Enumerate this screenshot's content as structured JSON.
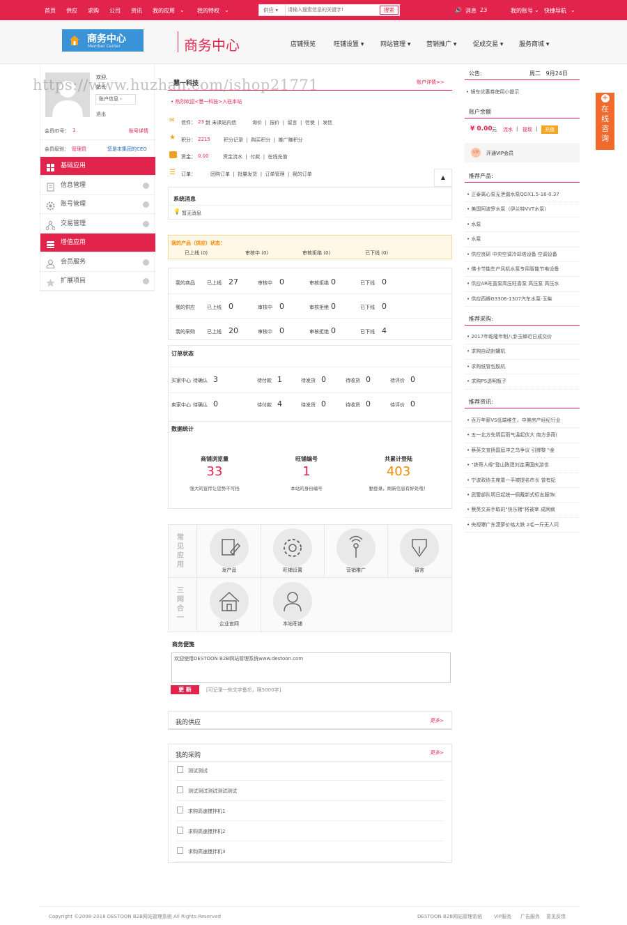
{
  "topnav": {
    "left": [
      "首页",
      "供应",
      "求购",
      "公司",
      "资讯",
      "我的应用",
      "我的特权"
    ],
    "search_type": "供应",
    "search_placeholder": "请输入搜索信息的关键字!",
    "search_button": "搜索",
    "messages_label": "消息",
    "messages_count": "23",
    "account": "我的账号",
    "quicknav": "快捷导航"
  },
  "header": {
    "logo_title": "商务中心",
    "logo_sub": "Member Center",
    "brand": "商务中心",
    "nav": [
      "店铺预览",
      "旺铺设置",
      "网站管理",
      "营销推广",
      "促成交易",
      "服务商城"
    ]
  },
  "watermark": "https://www.huzhan.com/ishop21771",
  "left": {
    "welcome": "欢迎,",
    "user_prefix": "站长",
    "account_info": "账户信息",
    "logout": "退出",
    "member_id_label": "会员ID号：",
    "member_id": "1",
    "account_detail": "账号详情",
    "level_label": "会员级别：",
    "level": "管理员",
    "ceo_link": "您是本集团的CEO",
    "menu": [
      {
        "label": "基础应用",
        "icon": "grid-icon",
        "red": true
      },
      {
        "label": "信息管理",
        "icon": "document-icon",
        "red": false
      },
      {
        "label": "账号管理",
        "icon": "gear-icon",
        "red": false
      },
      {
        "label": "交易管理",
        "icon": "network-icon",
        "red": false
      },
      {
        "label": "增值应用",
        "icon": "stack-icon",
        "red": true
      },
      {
        "label": "会员服务",
        "icon": "user-icon",
        "red": false
      },
      {
        "label": "扩展项目",
        "icon": "star-icon",
        "red": false
      }
    ]
  },
  "center": {
    "company": "慧一科技",
    "account_detail_link": "账户详情>>",
    "welcome": "热烈欢迎<慧一科技>入驻本站",
    "rows": {
      "mail": {
        "label": "信件：",
        "count": "23",
        "unit": "封 未读站内信",
        "links": [
          "询价",
          "报价",
          "留言",
          "信使",
          "发信"
        ]
      },
      "points": {
        "label": "积分：",
        "value": "2215",
        "links": [
          "积分记录",
          "购买积分",
          "推广赚积分"
        ]
      },
      "funds": {
        "label": "资金：",
        "value": "0.00",
        "links": [
          "资金流水",
          "付款",
          "在线充值"
        ]
      },
      "orders": {
        "label": "订单：",
        "links": [
          "团购订单",
          "批量发货",
          "订单管理",
          "我的订单"
        ]
      }
    },
    "sys_msg_title": "系统消息",
    "sys_msg": "暂无消息",
    "supply_status": {
      "title": "我的产品（供应）状态：",
      "items": [
        "已上线 (0)",
        "审核中 (0)",
        "审核拒绝 (0)",
        "已下线 (0)"
      ]
    },
    "product_table": [
      {
        "name": "我的商品",
        "vals": [
          [
            "已上线",
            "27"
          ],
          [
            "审核中",
            "0"
          ],
          [
            "审核拒绝",
            "0"
          ],
          [
            "已下线",
            "0"
          ]
        ]
      },
      {
        "name": "我的供应",
        "vals": [
          [
            "已上线",
            "0"
          ],
          [
            "审核中",
            "0"
          ],
          [
            "审核拒绝",
            "0"
          ],
          [
            "已下线",
            "0"
          ]
        ]
      },
      {
        "name": "我的采购",
        "vals": [
          [
            "已上线",
            "20"
          ],
          [
            "审核中",
            "0"
          ],
          [
            "审核拒绝",
            "0"
          ],
          [
            "已下线",
            "4"
          ]
        ]
      }
    ],
    "order_title": "订单状态",
    "order_table": [
      {
        "name": "买家中心",
        "vals": [
          [
            "待确认",
            "3"
          ],
          [
            "待付款",
            "1"
          ],
          [
            "待发货",
            "0"
          ],
          [
            "待收货",
            "0"
          ],
          [
            "待评价",
            "0"
          ]
        ]
      },
      {
        "name": "卖家中心",
        "vals": [
          [
            "待确认",
            "0"
          ],
          [
            "待付款",
            "4"
          ],
          [
            "待发货",
            "0"
          ],
          [
            "待收货",
            "0"
          ],
          [
            "待评价",
            "0"
          ]
        ]
      }
    ],
    "stats_title": "数据统计",
    "stats": [
      {
        "label": "商铺浏览量",
        "value": "33",
        "desc": "强大的宣传让您势不可挡",
        "color": "#e2244d"
      },
      {
        "label": "旺铺编号",
        "value": "1",
        "desc": "本站的身份编号",
        "color": "#e2244d"
      },
      {
        "label": "共累计登陆",
        "value": "403",
        "desc": "勤登录，刷新信息有好处哦！",
        "color": "#f08a00"
      }
    ],
    "apps_side1": "常见应用",
    "apps_side2": "三网合一",
    "apps": [
      {
        "label": "发产品",
        "icon": "edit-icon"
      },
      {
        "label": "旺铺设置",
        "icon": "gear-icon"
      },
      {
        "label": "营销推广",
        "icon": "broadcast-icon"
      },
      {
        "label": "留言",
        "icon": "pen-icon"
      },
      {
        "label": "企业官网",
        "icon": "home-icon"
      },
      {
        "label": "本站旺铺",
        "icon": "user-icon"
      }
    ],
    "memo_title": "商务便笺",
    "memo_text": "欢迎使用DESTOON B2B网站管理系统www.destoon.com",
    "memo_button": "更 新",
    "memo_hint": "[可记录一些文字备忘，限5000字]",
    "my_supply": "我的供应",
    "my_buy": "我的采购",
    "more": "更多>",
    "buy_list": [
      "测试测试",
      "测试测试测试测试测试",
      "求购高速搅拌机1",
      "求购高速搅拌机2",
      "求购高速搅拌机3"
    ]
  },
  "right": {
    "notice_label": "公告:",
    "date": "周二   9月24日",
    "notice_item": "镜车优惠券使用小提示",
    "balance_title": "账户余额",
    "balance": "¥ 0.00",
    "balance_unit": "元",
    "balance_links": [
      "流水",
      "提现"
    ],
    "recharge": "充值",
    "vip": "开通VIP会员",
    "rec_products_title": "推荐产品:",
    "rec_products": [
      "正泰离心泵无泄漏水泵QDX1.5-16-0.37",
      "美国阿波罗水泵（伊兰特VVT水泵）",
      "水泵",
      "水泵",
      "供应良研 中央空调冷却塔设备 空调设备",
      "佛卡节能生产风机水泵专用智能节电设备",
      "供应AR旺喜泵高压旺喜泵 高压泵 高压水",
      "供应西峰G3306-1307汽车水泵-玉柴"
    ],
    "rec_buy_title": "推荐采购:",
    "rec_buy": [
      "2017年乾隆年制八卦玉蝉近日成交价",
      "求购自动封罐机",
      "求购纸管包胶机",
      "求购PS透明瓶子"
    ],
    "rec_news_title": "推荐资讯:",
    "rec_news": [
      "百万年薪VS低端维生，中美房产经纪行业",
      "五一北方先晴后雨气温起伏大 南方多雨(",
      "蔡英文宣扬国庭冲之乌争议 引撑黎 \"金",
      "\"铁哥人缘\"登山陈建刘连满国庆游世",
      "宁波政协主席童一平被提名市长 曾有妃",
      "武警部队明日起统一佩戴新式标志服饰(",
      "蔡英文亲手取的\"快乐猪\"将被宰 成网疯",
      "央视曝广东漠萝价格大跌 2毛一斤无人问"
    ]
  },
  "float_tab": "在线咨询",
  "footer": {
    "copyright": "Copyright ©2008-2018 DESTOON B2B网站管理系统 All Rights Reserved",
    "links": [
      "DESTOON B2B网站管理系统",
      "VIP服务",
      "广告服务",
      "意见反馈"
    ]
  }
}
